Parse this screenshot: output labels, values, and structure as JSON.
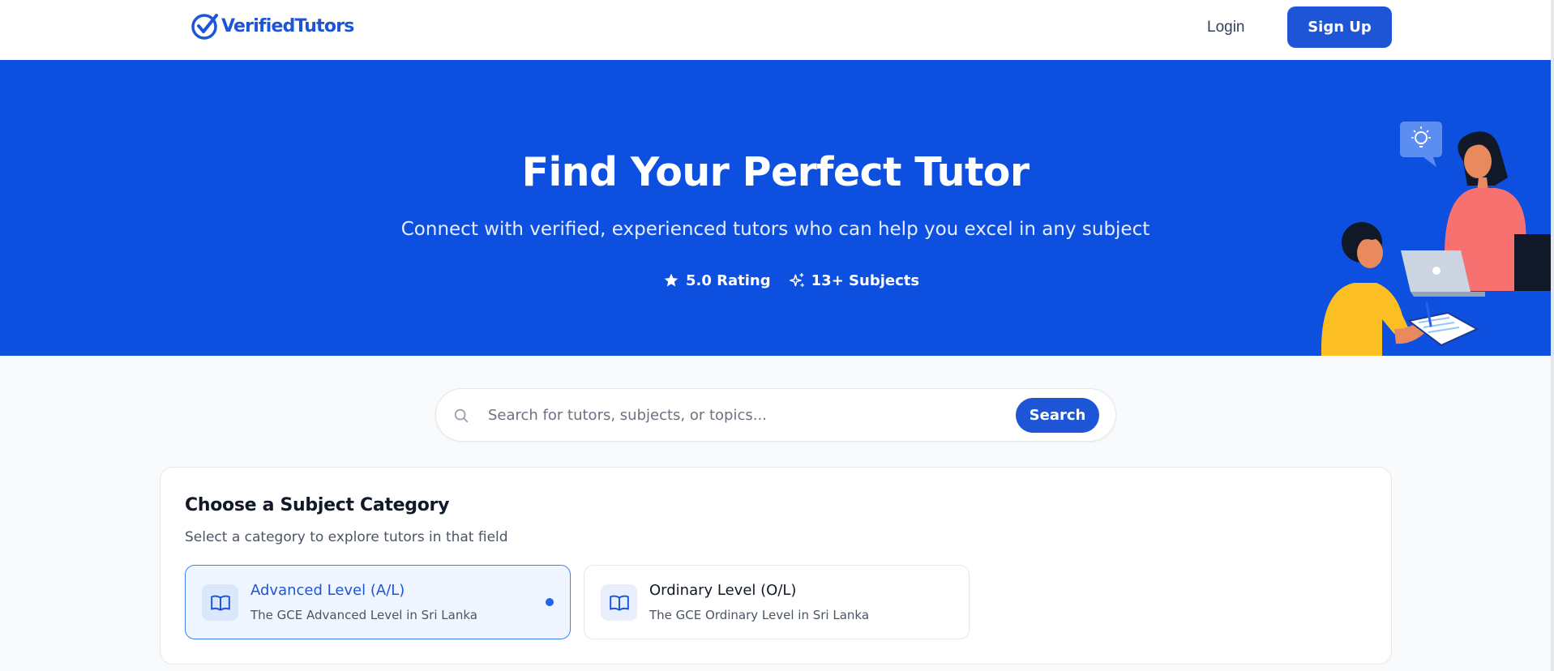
{
  "header": {
    "logo_text": "VerifiedTutors",
    "login_label": "Login",
    "signup_label": "Sign Up"
  },
  "hero": {
    "title": "Find Your Perfect Tutor",
    "subtitle": "Connect with verified, experienced tutors who can help you excel in any subject",
    "stats": [
      {
        "icon": "star-icon",
        "label": "5.0 Rating"
      },
      {
        "icon": "sparkles-icon",
        "label": "13+ Subjects"
      }
    ]
  },
  "search": {
    "placeholder": "Search for tutors, subjects, or topics...",
    "button_label": "Search"
  },
  "categories": {
    "title": "Choose a Subject Category",
    "subtitle": "Select a category to explore tutors in that field",
    "options": [
      {
        "title": "Advanced Level (A/L)",
        "description": "The GCE Advanced Level in Sri Lanka",
        "selected": true,
        "icon": "book-open-icon"
      },
      {
        "title": "Ordinary Level (O/L)",
        "description": "The GCE Ordinary Level in Sri Lanka",
        "selected": false,
        "icon": "book-open-icon"
      }
    ]
  },
  "colors": {
    "brand": "#1d55d6",
    "hero_bg": "#0d4fdf",
    "selected_bg": "#eff6ff",
    "selected_border": "#3b82f6"
  }
}
